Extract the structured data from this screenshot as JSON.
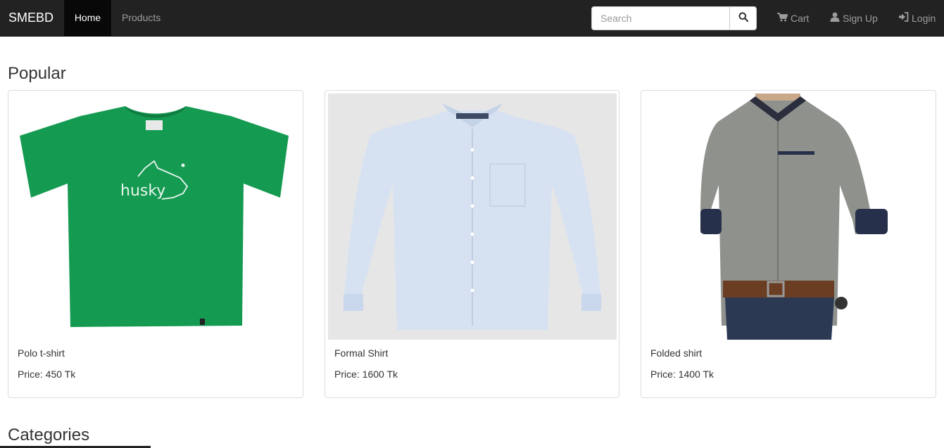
{
  "navbar": {
    "brand": "SMEBD",
    "links": [
      {
        "label": "Home",
        "active": true
      },
      {
        "label": "Products",
        "active": false
      }
    ],
    "search": {
      "placeholder": "Search",
      "value": "",
      "button_icon": "search-icon"
    },
    "right_links": [
      {
        "label": "Cart",
        "icon": "cart-icon"
      },
      {
        "label": "Sign Up",
        "icon": "user-icon"
      },
      {
        "label": "Login",
        "icon": "login-icon"
      }
    ]
  },
  "popular": {
    "heading": "Popular",
    "products": [
      {
        "name": "Polo t-shirt",
        "price": "Price: 450 Tk",
        "image": "green-tshirt-image",
        "print_text": "husky"
      },
      {
        "name": "Formal Shirt",
        "price": "Price: 1600 Tk",
        "image": "light-blue-formal-shirt-image"
      },
      {
        "name": "Folded shirt",
        "price": "Price: 1400 Tk",
        "image": "grey-folded-sleeve-shirt-image"
      }
    ]
  },
  "categories": {
    "heading": "Categories"
  },
  "colors": {
    "navbar_bg": "#222222",
    "active_link_bg": "#080808",
    "link": "#9d9d9d",
    "border": "#dddddd",
    "text": "#333333"
  }
}
